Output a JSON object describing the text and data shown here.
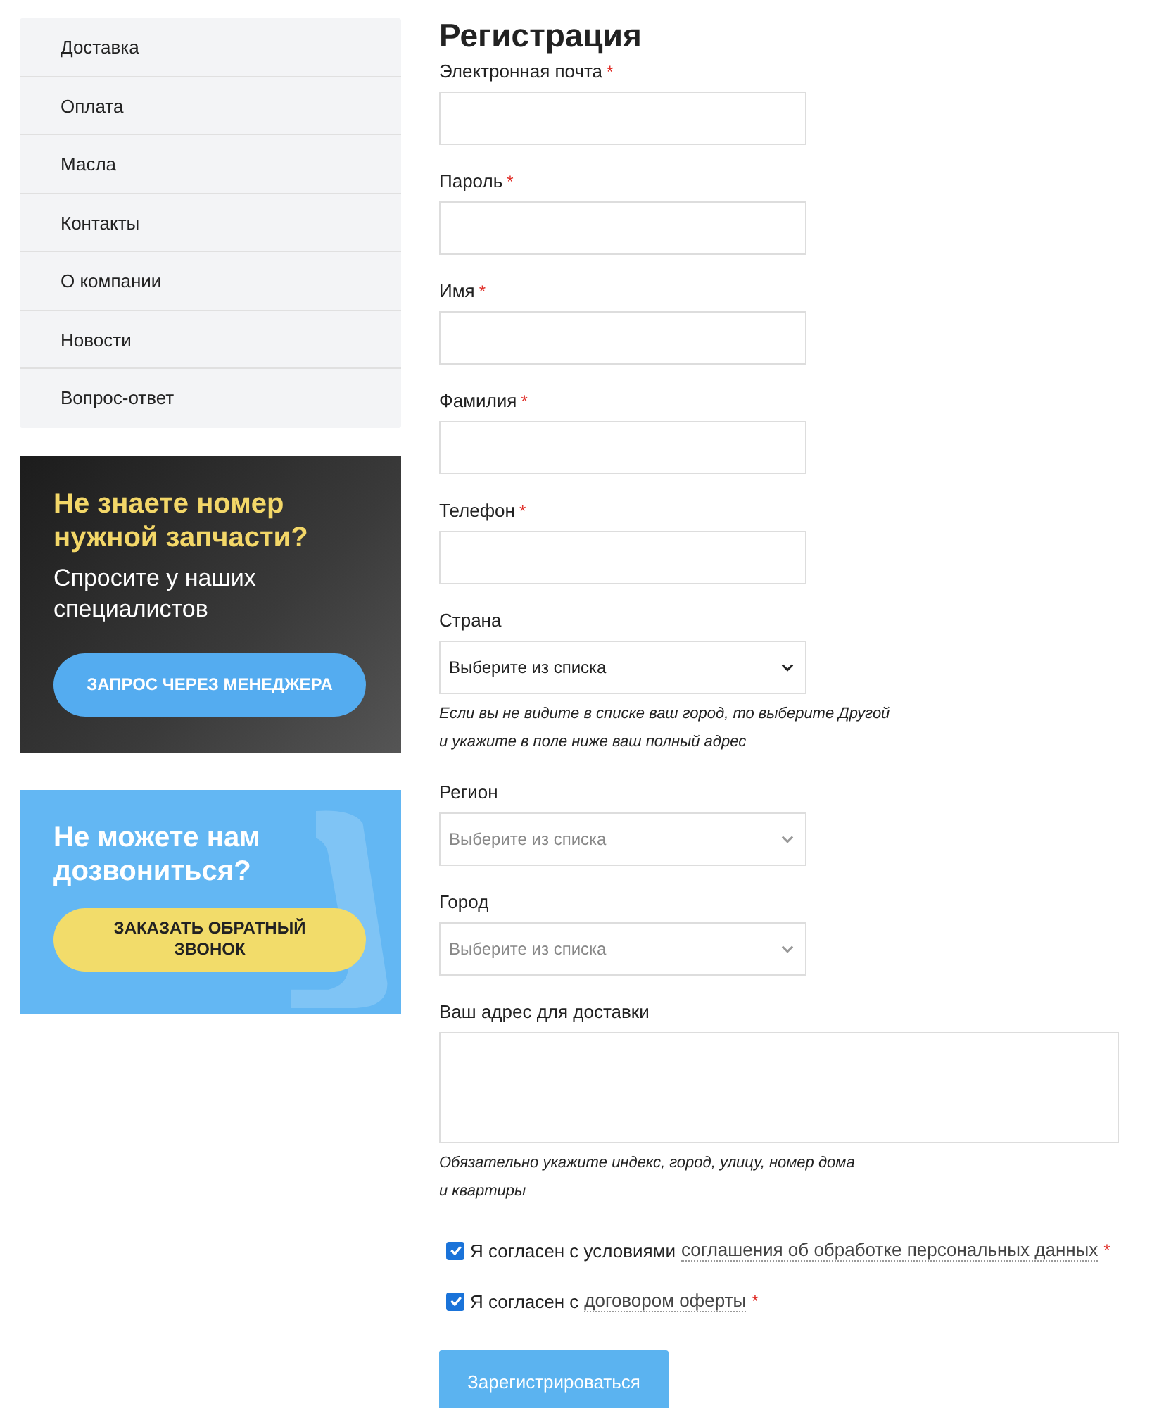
{
  "sidebar": {
    "items": [
      {
        "label": "Доставка"
      },
      {
        "label": "Оплата"
      },
      {
        "label": "Масла"
      },
      {
        "label": "Контакты"
      },
      {
        "label": "О компании"
      },
      {
        "label": "Новости"
      },
      {
        "label": "Вопрос-ответ"
      }
    ]
  },
  "banners": [
    {
      "kind": "dark",
      "title": "Не знаете номер нужной запчасти?",
      "subtitle": "Спросите у наших специалистов",
      "button": "ЗАПРОС ЧЕРЕЗ МЕНЕДЖЕРА"
    },
    {
      "kind": "callback",
      "title": "Не можете нам дозвониться?",
      "button": "ЗАКАЗАТЬ ОБРАТНЫЙ ЗВОНОК"
    }
  ],
  "form": {
    "title": "Регистрация",
    "fields": [
      {
        "kind": "text",
        "label": "Электронная почта",
        "asterisk": "*"
      },
      {
        "kind": "text",
        "label": "Пароль",
        "asterisk": "*"
      },
      {
        "kind": "text",
        "label": "Имя",
        "asterisk": "*"
      },
      {
        "kind": "text",
        "label": "Фамилия",
        "asterisk": "*"
      },
      {
        "kind": "text",
        "label": "Телефон",
        "asterisk": "*"
      },
      {
        "kind": "select",
        "label": "Страна",
        "value": "Выберите из списка",
        "disabled": false,
        "hint": [
          "Если вы не видите в списке ваш город, то выберите Другой",
          "и укажите в поле ниже ваш полный адрес"
        ]
      },
      {
        "kind": "select",
        "label": "Регион",
        "value": "Выберите из списка",
        "disabled": true
      },
      {
        "kind": "select",
        "label": "Город",
        "value": "Выберите из списка",
        "disabled": true
      },
      {
        "kind": "textarea",
        "label": "Ваш адрес для доставки",
        "hint": [
          "Обязательно укажите индекс, город, улицу, номер дома",
          "и квартиры"
        ]
      }
    ],
    "consents": [
      {
        "checked": true,
        "text": "Я согласен с условиями",
        "link": "соглашения об обработке персональных данных",
        "asterisk": "*"
      },
      {
        "checked": true,
        "text": "Я согласен с",
        "link": "договором оферты",
        "asterisk": "*"
      }
    ],
    "submit": "Зарегистрироваться"
  }
}
